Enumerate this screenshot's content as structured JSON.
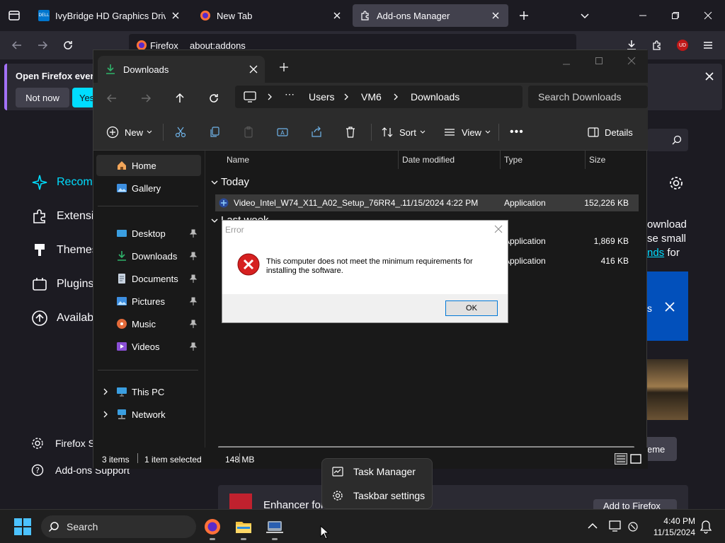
{
  "browser": {
    "tabs": [
      {
        "title": "IvyBridge HD Graphics Driver | Dell",
        "icon": "dell-icon",
        "active": false
      },
      {
        "title": "New Tab",
        "icon": "firefox-icon",
        "active": false
      },
      {
        "title": "Add-ons Manager",
        "icon": "puzzle-icon",
        "active": true
      }
    ],
    "identity_label": "Firefox",
    "url": "about:addons",
    "notification": {
      "text": "Open Firefox every",
      "not_now": "Not now",
      "yes": "Yes,"
    },
    "categories": [
      "Recomm",
      "Extensio",
      "Themes",
      "Plugins",
      "Availab"
    ],
    "right_text": [
      "ownload",
      "se small",
      "nds",
      "for"
    ],
    "right_button": "eme",
    "footer": {
      "settings": "Firefox S",
      "support": "Add-ons Support"
    },
    "recommended_item": "Enhancer for",
    "add_button": "Add to Firefox",
    "profile_badge": "UD"
  },
  "explorer": {
    "tab_title": "Downloads",
    "breadcrumb": [
      "Users",
      "VM6",
      "Downloads"
    ],
    "search_placeholder": "Search Downloads",
    "toolbar": {
      "new": "New",
      "sort": "Sort",
      "view": "View",
      "details": "Details"
    },
    "nav": {
      "top": [
        {
          "label": "Home",
          "icon": "home-icon"
        },
        {
          "label": "Gallery",
          "icon": "gallery-icon"
        }
      ],
      "pinned": [
        {
          "label": "Desktop",
          "icon": "desktop-icon"
        },
        {
          "label": "Downloads",
          "icon": "download-icon"
        },
        {
          "label": "Documents",
          "icon": "documents-icon"
        },
        {
          "label": "Pictures",
          "icon": "pictures-icon"
        },
        {
          "label": "Music",
          "icon": "music-icon"
        },
        {
          "label": "Videos",
          "icon": "videos-icon"
        }
      ],
      "bottom": [
        {
          "label": "This PC",
          "icon": "pc-icon"
        },
        {
          "label": "Network",
          "icon": "network-icon"
        }
      ]
    },
    "columns": [
      "Name",
      "Date modified",
      "Type",
      "Size"
    ],
    "groups": [
      {
        "label": "Today",
        "files": [
          {
            "name": "Video_Intel_W74_X11_A02_Setup_76RR4_...",
            "date": "11/15/2024 4:22 PM",
            "type": "Application",
            "size": "152,226 KB"
          }
        ]
      },
      {
        "label": "Last week",
        "files": [
          {
            "name": "",
            "date": "",
            "type": "Application",
            "size": "1,869 KB"
          },
          {
            "name": "",
            "date": "",
            "type": "Application",
            "size": "416 KB"
          }
        ]
      }
    ],
    "status": {
      "items": "3 items",
      "selected": "1 item selected",
      "size": "148 MB"
    }
  },
  "dialog": {
    "title": "Error",
    "message": "This computer does not meet the minimum requirements for installing the software.",
    "ok": "OK"
  },
  "context_menu": {
    "task_manager": "Task Manager",
    "taskbar_settings": "Taskbar settings"
  },
  "taskbar": {
    "search": "Search",
    "time": "4:40 PM",
    "date": "11/15/2024"
  },
  "colors": {
    "firefox_accent": "#00ddff",
    "error_red": "#d62020",
    "windows_blue": "#0078d7"
  }
}
